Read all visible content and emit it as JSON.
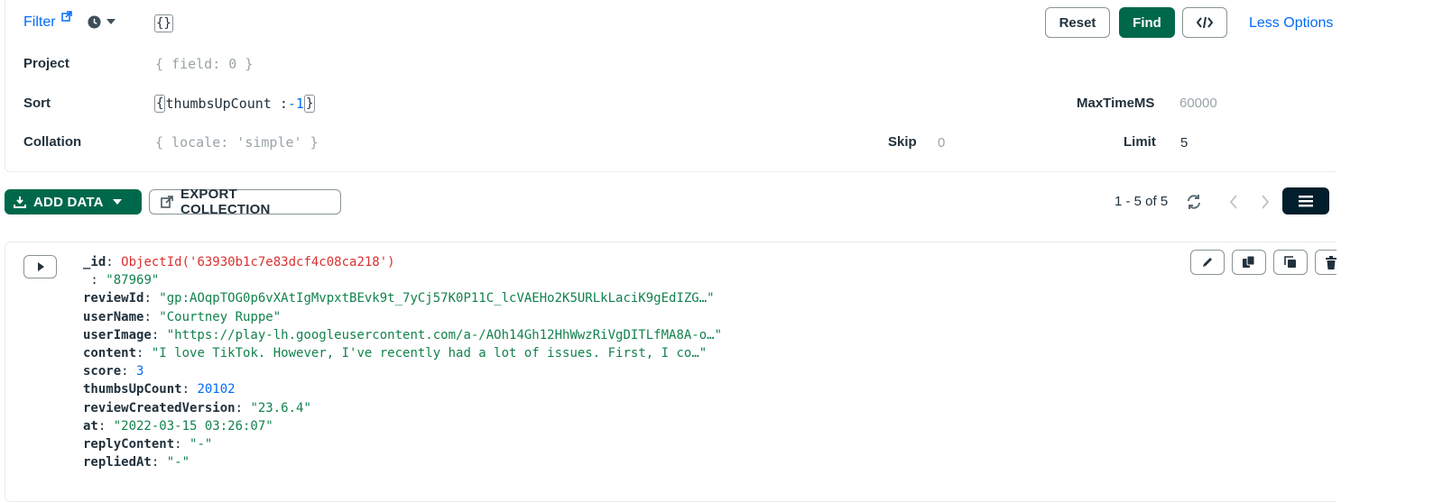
{
  "query": {
    "filter_label": "Filter",
    "filter_value": "{}",
    "project_label": "Project",
    "project_placeholder": "{ field: 0 }",
    "sort_label": "Sort",
    "sort_open": "{",
    "sort_key": "thumbsUpCount : ",
    "sort_value": "-1",
    "sort_close": "}",
    "collation_label": "Collation",
    "collation_placeholder": "{ locale: 'simple' }",
    "skip_label": "Skip",
    "skip_placeholder": "0",
    "limit_label": "Limit",
    "limit_value": "5",
    "maxtime_label": "MaxTimeMS",
    "maxtime_placeholder": "60000",
    "reset_label": "Reset",
    "find_label": "Find",
    "less_options_label": "Less Options"
  },
  "toolbar": {
    "add_data_label": "ADD DATA",
    "export_label": "EXPORT COLLECTION",
    "pagination": "1 - 5 of 5"
  },
  "document": {
    "id_key": "_id",
    "id_value": "ObjectId('63930b1c7e83dcf4c08ca218')",
    "fields": [
      {
        "key": "",
        "value": "\"87969\"",
        "type": "s"
      },
      {
        "key": "reviewId",
        "value": "\"gp:AOqpTOG0p6vXAtIgMvpxtBEvk9t_7yCj57K0P11C_lcVAEHo2K5URLkLaciK9gEdIZG…\"",
        "type": "s"
      },
      {
        "key": "userName",
        "value": "\"Courtney Ruppe\"",
        "type": "s"
      },
      {
        "key": "userImage",
        "value": "\"https://play-lh.googleusercontent.com/a-/AOh14Gh12HhWwzRiVgDITLfMA8A-o…\"",
        "type": "s"
      },
      {
        "key": "content",
        "value": "\"I love TikTok. However, I've recently had a lot of issues. First, I co…\"",
        "type": "s"
      },
      {
        "key": "score",
        "value": "3",
        "type": "n"
      },
      {
        "key": "thumbsUpCount",
        "value": "20102",
        "type": "n"
      },
      {
        "key": "reviewCreatedVersion",
        "value": "\"23.6.4\"",
        "type": "s"
      },
      {
        "key": "at",
        "value": "\"2022-03-15 03:26:07\"",
        "type": "s"
      },
      {
        "key": "replyContent",
        "value": "\"-\"",
        "type": "s"
      },
      {
        "key": "repliedAt",
        "value": "\"-\"",
        "type": "s"
      }
    ]
  },
  "icons": {
    "filter_help": "external-link-icon",
    "history": "clock-icon",
    "code": "code-icon",
    "refresh": "refresh-icon",
    "prev": "chevron-left-icon",
    "next": "chevron-right-icon",
    "list_view": "list-icon",
    "json_view": "braces-icon",
    "expand": "caret-right-icon",
    "edit": "pencil-icon",
    "copy": "copy-icon",
    "clone": "clone-icon",
    "delete": "trash-icon"
  }
}
